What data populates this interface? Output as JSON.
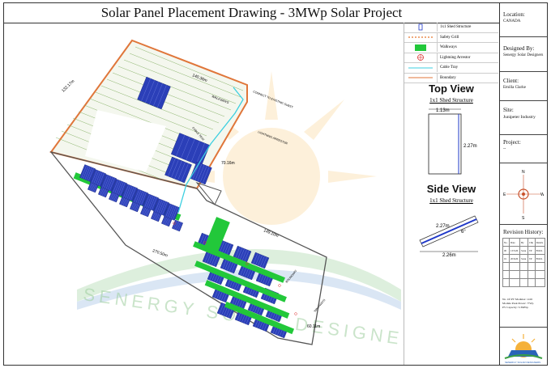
{
  "title": "Solar Panel Placement Drawing - 3MWp Solar Project",
  "legend": [
    {
      "symbol": "shed-structure-icon",
      "label": "1x1 Shed Structure"
    },
    {
      "symbol": "safety-grill-icon",
      "label": "Safety Grill"
    },
    {
      "symbol": "walkway-icon",
      "label": "Walkways"
    },
    {
      "symbol": "lightning-arrestor-icon",
      "label": "Lightning Arrestor"
    },
    {
      "symbol": "cable-tray-icon",
      "label": "Cable Tray"
    },
    {
      "symbol": "boundary-icon",
      "label": "Boundary"
    }
  ],
  "top_view": {
    "title": "Top View",
    "subtitle": "1x1 Shed Structure",
    "width": "1.13m",
    "height": "2.27m"
  },
  "side_view": {
    "title": "Side View",
    "subtitle": "1x1 Shed Structure",
    "length": "2.27m",
    "angle": "6°",
    "base": "2.26m"
  },
  "info": {
    "location_label": "Location:",
    "location": "CANADA",
    "designed_label": "Designed By:",
    "designed": "Senergy Solar Designers",
    "client_label": "Client:",
    "client": "Emilla Clarke",
    "site_label": "Site:",
    "site": "Junipeter Industry",
    "project_label": "Project:",
    "project": "--",
    "revision_label": "Revision History:",
    "revision_headers": [
      "No.",
      "Date",
      "By",
      "Chk",
      "Details"
    ],
    "revision_rows": [
      [
        "00",
        "13/5/26",
        "Sonu",
        "TP",
        "FOOL"
      ],
      [
        "01",
        "20/6/26",
        "Sonu",
        "TP",
        "FOOL"
      ]
    ],
    "spec_lines": [
      "No. Of PV Modules:   1416",
      "Module Peak Power:   ??Wp",
      "PV Capacity:   3.3MWp"
    ],
    "logo_text": "SENERGY SOLAR DESIGNERS"
  },
  "compass": {
    "north": "N",
    "south": "S",
    "east": "E",
    "west": "W"
  },
  "dimensions": [
    "132.17m",
    "140.36m",
    "70.16m",
    "149.10m",
    "270.50m",
    "60.11m"
  ],
  "annotations": [
    "WALKWAYS",
    "CONNECT TO EXISTING SUBST",
    "LIGHTNING ARRESTOR",
    "CABLE TRAY",
    "NORTH",
    "BOUNDARY",
    "WALKWAYS"
  ],
  "watermark": "SENERGY SOLAR DESIGNERS"
}
